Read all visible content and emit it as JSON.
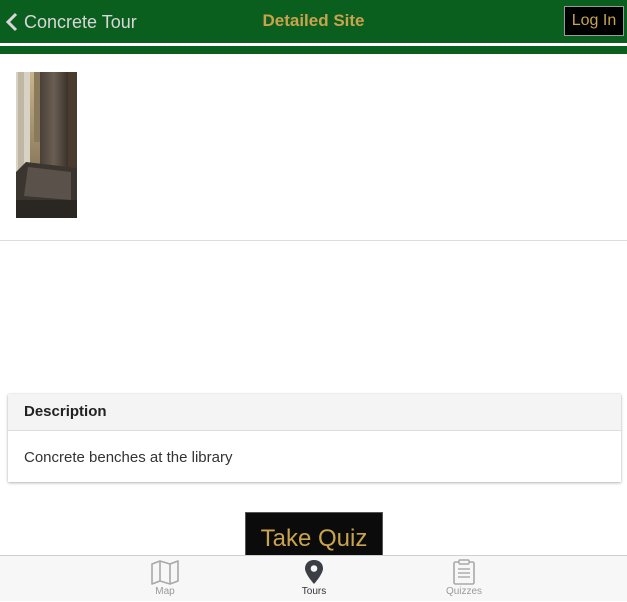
{
  "header": {
    "back_label": "Concrete Tour",
    "title": "Detailed Site",
    "login_label": "Log In",
    "brand_color": "#0a5e1e",
    "accent_color": "#c9a34d"
  },
  "site": {
    "photo_icon": "site-photo"
  },
  "description": {
    "heading": "Description",
    "text": "Concrete benches at the library"
  },
  "quiz": {
    "button_label": "Take Quiz"
  },
  "tabbar": {
    "tabs": [
      {
        "label": "Map",
        "icon": "map-icon",
        "active": false
      },
      {
        "label": "Tours",
        "icon": "location-pin-icon",
        "active": true
      },
      {
        "label": "Quizzes",
        "icon": "clipboard-icon",
        "active": false
      }
    ]
  }
}
